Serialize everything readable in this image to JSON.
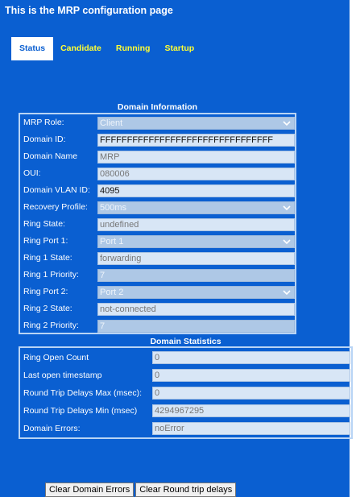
{
  "page_title": "This is the MRP configuration page",
  "tabs": [
    {
      "label": "Status",
      "active": true
    },
    {
      "label": "Candidate",
      "active": false
    },
    {
      "label": "Running",
      "active": false
    },
    {
      "label": "Startup",
      "active": false
    }
  ],
  "domain_info": {
    "title": "Domain Information",
    "fields": {
      "mrp_role": {
        "label": "MRP Role:",
        "value": "Client"
      },
      "domain_id": {
        "label": "Domain ID:",
        "value": "FFFFFFFFFFFFFFFFFFFFFFFFFFFFFFFF"
      },
      "domain_name": {
        "label": "Domain Name",
        "value": "MRP"
      },
      "oui": {
        "label": "OUI:",
        "value": "080006"
      },
      "domain_vlan_id": {
        "label": "Domain VLAN ID:",
        "value": "4095"
      },
      "recovery_profile": {
        "label": "Recovery Profile:",
        "value": "500ms"
      },
      "ring_state": {
        "label": "Ring State:",
        "value": "undefined"
      },
      "ring_port_1": {
        "label": "Ring Port 1:",
        "value": "Port 1"
      },
      "ring_1_state": {
        "label": "Ring 1 State:",
        "value": "forwarding"
      },
      "ring_1_priority": {
        "label": "Ring 1 Priority:",
        "value": "7"
      },
      "ring_port_2": {
        "label": "Ring Port 2:",
        "value": "Port 2"
      },
      "ring_2_state": {
        "label": "Ring 2 State:",
        "value": "not-connected"
      },
      "ring_2_priority": {
        "label": "Ring 2 Priority:",
        "value": "7"
      }
    }
  },
  "domain_stats": {
    "title": "Domain Statistics",
    "fields": {
      "ring_open_count": {
        "label": "Ring Open Count",
        "value": "0"
      },
      "last_open_timestamp": {
        "label": "Last open timestamp",
        "value": "0"
      },
      "rtd_max": {
        "label": "Round Trip Delays Max (msec):",
        "value": "0"
      },
      "rtd_min": {
        "label": "Round Trip Delays Min (msec)",
        "value": "4294967295"
      },
      "domain_errors": {
        "label": "Domain Errors:",
        "value": "noError"
      }
    }
  },
  "buttons": {
    "clear_domain_errors": "Clear Domain Errors",
    "clear_round_trip_delays": "Clear Round trip delays"
  },
  "colors": {
    "panel_bg": "#0a5fd1",
    "tab_text": "#ffff33",
    "field_bg": "#d8e6f6",
    "field_disabled_bg": "#aec8e6"
  }
}
